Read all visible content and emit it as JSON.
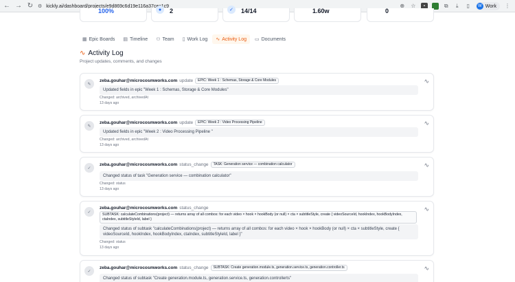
{
  "browser": {
    "url": "kickly.ai/dashboard/projects/e9d869c6d19e116a37cec1c9",
    "profile_label": "Work",
    "profile_initial": "W"
  },
  "stats": [
    {
      "value": "100%"
    },
    {
      "value": "2"
    },
    {
      "value": "14/14"
    },
    {
      "value": "1.60w"
    },
    {
      "value": "0"
    }
  ],
  "tabs": [
    {
      "label": "Epic Boards",
      "icon": "board-icon",
      "glyph": "▦"
    },
    {
      "label": "Timeline",
      "icon": "timeline-icon",
      "glyph": "▤"
    },
    {
      "label": "Team",
      "icon": "users-icon",
      "glyph": "⚇"
    },
    {
      "label": "Work Log",
      "icon": "file-icon",
      "glyph": "▯"
    },
    {
      "label": "Activity Log",
      "icon": "activity-icon",
      "glyph": "∿"
    },
    {
      "label": "Documents",
      "icon": "document-icon",
      "glyph": "▭"
    }
  ],
  "header": {
    "title": "Activity Log",
    "subtitle": "Project updates, comments, and changes"
  },
  "activities": [
    {
      "user": "zeba.gouhar@microcosmworks.com",
      "action": "update",
      "badge": "EPIC: Week 1 : Schemas, Storage & Core Modules",
      "detail": "Updated fields in epic \"Week 1 : Schemas, Storage & Core Modules\"",
      "changed": "Changed: archived, archivedAt",
      "time": "13 days ago"
    },
    {
      "user": "zeba.gouhar@microcosmworks.com",
      "action": "update",
      "badge": "EPIC: Week 2 : Video Processing Pipeline",
      "detail": "Updated fields in epic \"Week 2 : Video Processing Pipeline \"",
      "changed": "Changed: archived, archivedAt",
      "time": "13 days ago"
    },
    {
      "user": "zeba.gouhar@microcosmworks.com",
      "action": "status_change",
      "badge": "TASK: Generation service — combination calculator",
      "detail": "Changed status of task \"Generation service — combination calculator\"",
      "changed": "Changed: status",
      "time": "13 days ago"
    },
    {
      "user": "zeba.gouhar@microcosmworks.com",
      "action": "status_change",
      "badge": "SUBTASK: calculateCombinations(project) — returns array of all combos: for each video × hook × hookBody (or null) × cta × subtitleStyle, create { videoSourceId, hookIndex, hookBodyIndex, ctaIndex, subtitleStyleId, label }",
      "detail": "Changed status of subtask \"calculateCombinations(project) — returns array of all combos: for each video × hook × hookBody (or null) × cta × subtitleStyle, create { videoSourceId, hookIndex, hookBodyIndex, ctaIndex, subtitleStyleId, label }\"",
      "changed": "Changed: status",
      "time": "13 days ago"
    },
    {
      "user": "zeba.gouhar@microcosmworks.com",
      "action": "status_change",
      "badge": "SUBTASK: Create generation.module.ts, generation.service.ts, generation.controller.ts",
      "detail": "Changed status of subtask \"Create generation.module.ts, generation.service.ts, generation.controllerts\"",
      "changed": "",
      "time": ""
    }
  ]
}
